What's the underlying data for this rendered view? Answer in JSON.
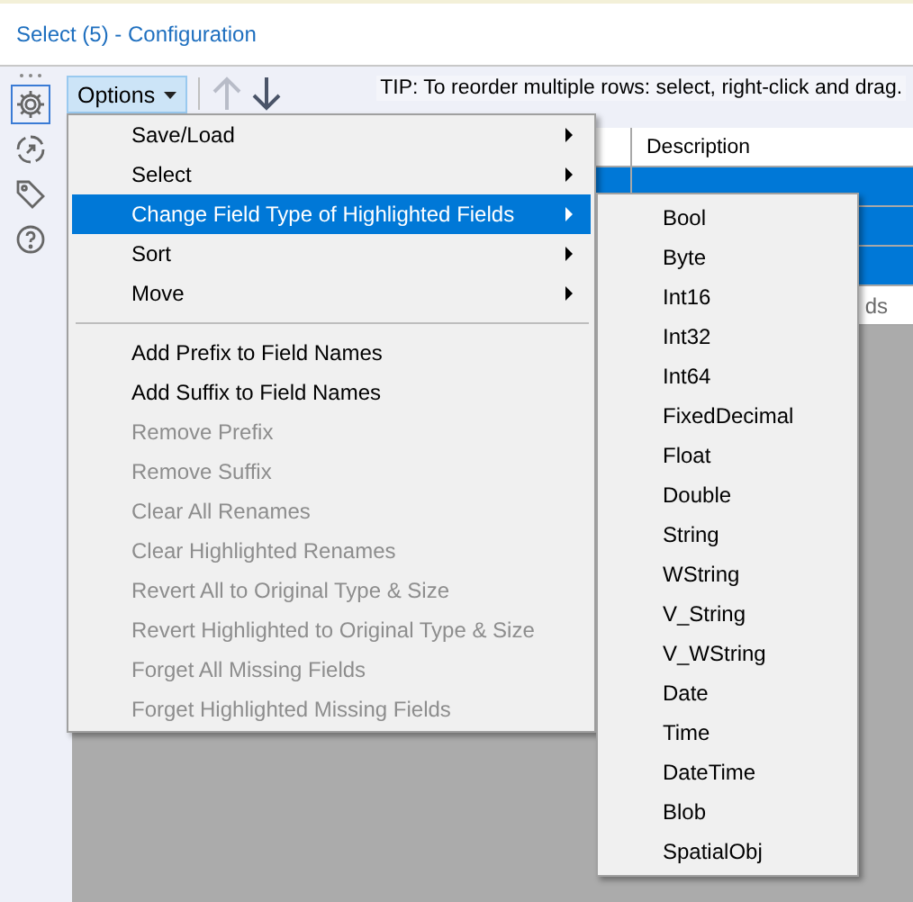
{
  "window": {
    "title": "Select (5) - Configuration"
  },
  "toolbar": {
    "options_button": "Options",
    "tip": "TIP: To reorder multiple rows: select, right-click and drag.",
    "move_up_disabled": true,
    "move_down_disabled": false
  },
  "sidebar": {
    "items": [
      {
        "selected": true
      },
      {
        "selected": false
      },
      {
        "selected": false
      },
      {
        "selected": false
      }
    ]
  },
  "table": {
    "columns": [
      "Description"
    ],
    "rows": [
      {
        "selected": true,
        "description": ""
      },
      {
        "selected": true,
        "description": ""
      },
      {
        "selected": true,
        "description": ""
      },
      {
        "selected": false,
        "description": "ds"
      }
    ]
  },
  "menu": {
    "items": [
      {
        "kind": "submenu",
        "label": "Save/Load",
        "disabled": false,
        "selected": false
      },
      {
        "kind": "submenu",
        "label": "Select",
        "disabled": false,
        "selected": false
      },
      {
        "kind": "submenu",
        "label": "Change Field Type of Highlighted Fields",
        "disabled": false,
        "selected": true
      },
      {
        "kind": "submenu",
        "label": "Sort",
        "disabled": false,
        "selected": false
      },
      {
        "kind": "submenu",
        "label": "Move",
        "disabled": false,
        "selected": false
      },
      {
        "kind": "separator"
      },
      {
        "kind": "item",
        "label": "Add Prefix to Field Names",
        "disabled": false,
        "selected": false
      },
      {
        "kind": "item",
        "label": "Add Suffix to Field Names",
        "disabled": false,
        "selected": false
      },
      {
        "kind": "item",
        "label": "Remove Prefix",
        "disabled": true,
        "selected": false
      },
      {
        "kind": "item",
        "label": "Remove Suffix",
        "disabled": true,
        "selected": false
      },
      {
        "kind": "item",
        "label": "Clear All Renames",
        "disabled": true,
        "selected": false
      },
      {
        "kind": "item",
        "label": "Clear Highlighted Renames",
        "disabled": true,
        "selected": false
      },
      {
        "kind": "item",
        "label": "Revert All to Original Type & Size",
        "disabled": true,
        "selected": false
      },
      {
        "kind": "item",
        "label": "Revert Highlighted to Original Type & Size",
        "disabled": true,
        "selected": false
      },
      {
        "kind": "item",
        "label": "Forget All Missing Fields",
        "disabled": true,
        "selected": false
      },
      {
        "kind": "item",
        "label": "Forget Highlighted Missing Fields",
        "disabled": true,
        "selected": false
      }
    ]
  },
  "submenu": {
    "items": [
      "Bool",
      "Byte",
      "Int16",
      "Int32",
      "Int64",
      "FixedDecimal",
      "Float",
      "Double",
      "String",
      "WString",
      "V_String",
      "V_WString",
      "Date",
      "Time",
      "DateTime",
      "Blob",
      "SpatialObj"
    ]
  }
}
